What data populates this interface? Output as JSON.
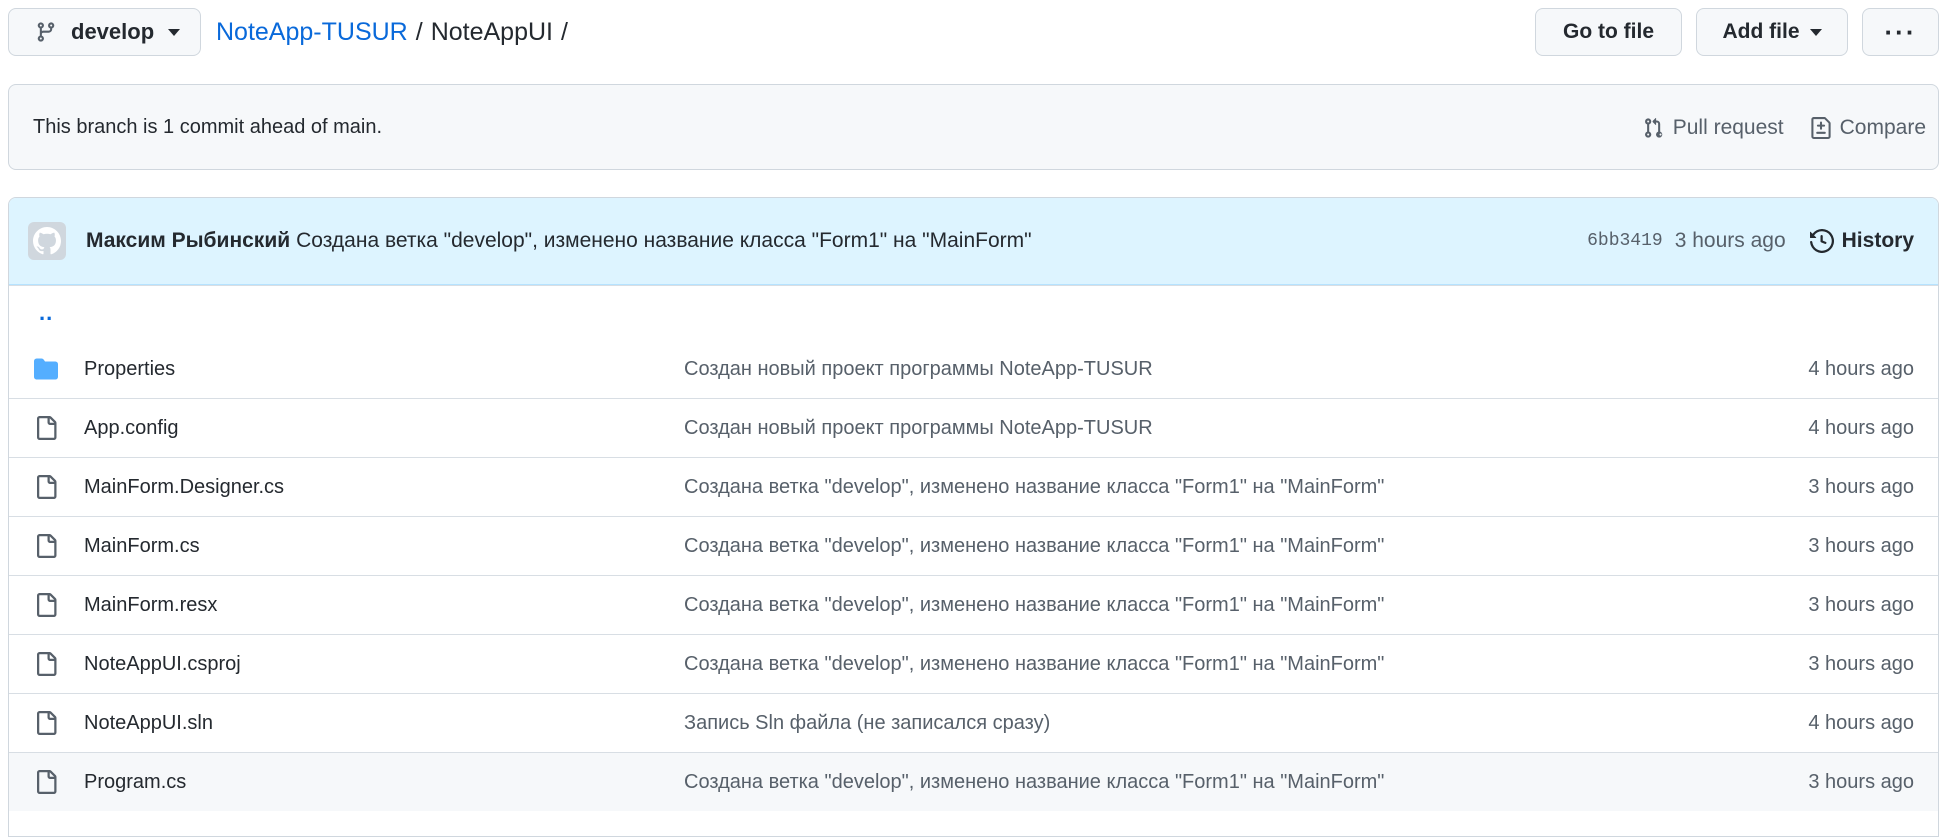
{
  "branch": {
    "name": "develop",
    "icon": "git-branch-icon"
  },
  "breadcrumb": {
    "repo": "NoteApp-TUSUR",
    "sep1": "/",
    "folder": "NoteAppUI",
    "sep2": "/"
  },
  "header_buttons": {
    "goto": "Go to file",
    "add_file": "Add file",
    "more": "···"
  },
  "ahead_bar": {
    "text": "This branch is 1 commit ahead of main.",
    "pull_request": "Pull request",
    "compare": "Compare"
  },
  "commit": {
    "author": "Максим Рыбинский",
    "message": "Создана ветка \"develop\", изменено название класса \"Form1\" на \"MainForm\"",
    "sha": "6bb3419",
    "time": "3 hours ago",
    "history": "History"
  },
  "parent_link": "..",
  "files": [
    {
      "type": "folder",
      "name": "Properties",
      "message": "Создан новый проект программы NoteApp-TUSUR",
      "time": "4 hours ago"
    },
    {
      "type": "file",
      "name": "App.config",
      "message": "Создан новый проект программы NoteApp-TUSUR",
      "time": "4 hours ago"
    },
    {
      "type": "file",
      "name": "MainForm.Designer.cs",
      "message": "Создана ветка \"develop\", изменено название класса \"Form1\" на \"MainForm\"",
      "time": "3 hours ago"
    },
    {
      "type": "file",
      "name": "MainForm.cs",
      "message": "Создана ветка \"develop\", изменено название класса \"Form1\" на \"MainForm\"",
      "time": "3 hours ago"
    },
    {
      "type": "file",
      "name": "MainForm.resx",
      "message": "Создана ветка \"develop\", изменено название класса \"Form1\" на \"MainForm\"",
      "time": "3 hours ago"
    },
    {
      "type": "file",
      "name": "NoteAppUI.csproj",
      "message": "Создана ветка \"develop\", изменено название класса \"Form1\" на \"MainForm\"",
      "time": "3 hours ago"
    },
    {
      "type": "file",
      "name": "NoteAppUI.sln",
      "message": "Запись Sln файла (не записался сразу)",
      "time": "4 hours ago"
    },
    {
      "type": "file",
      "name": "Program.cs",
      "message": "Создана ветка \"develop\", изменено название класса \"Form1\" на \"MainForm\"",
      "time": "3 hours ago"
    }
  ],
  "colors": {
    "link": "#0969da",
    "folder": "#54aeff",
    "commit_bg": "#ddf4ff"
  }
}
